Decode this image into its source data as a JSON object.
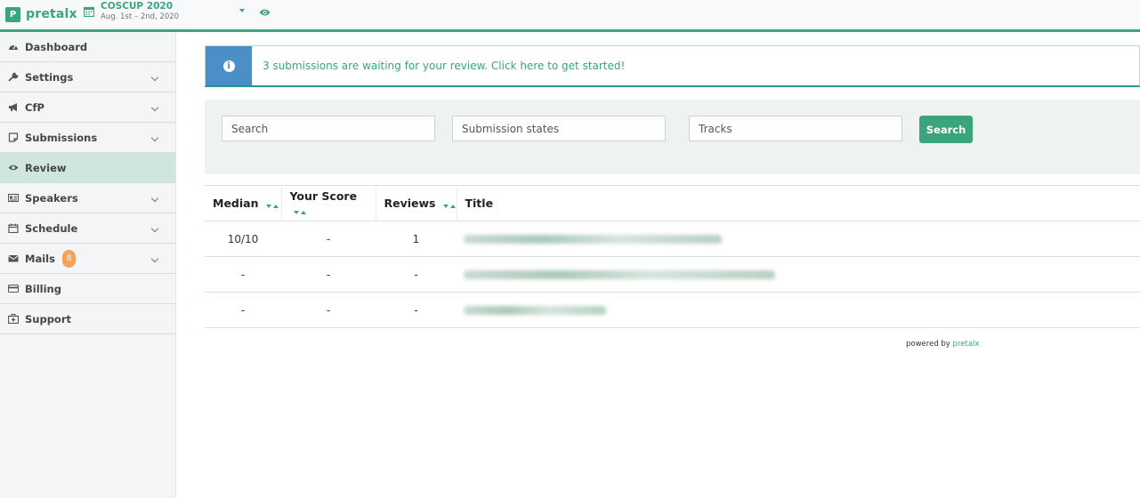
{
  "header": {
    "brand_logo": "P",
    "brand": "pretalx",
    "event_name": "COSCUP 2020",
    "event_dates": "Aug. 1st – 2nd, 2020",
    "accent": "#3aa57c"
  },
  "sidebar": {
    "items": [
      {
        "label": "Dashboard",
        "icon": "dashboard-icon",
        "expandable": false
      },
      {
        "label": "Settings",
        "icon": "wrench-icon",
        "expandable": true
      },
      {
        "label": "CfP",
        "icon": "bullhorn-icon",
        "expandable": true
      },
      {
        "label": "Submissions",
        "icon": "sticky-note-icon",
        "expandable": true
      },
      {
        "label": "Review",
        "icon": "eye-icon",
        "expandable": false,
        "active": true
      },
      {
        "label": "Speakers",
        "icon": "id-card-icon",
        "expandable": true
      },
      {
        "label": "Schedule",
        "icon": "calendar-icon",
        "expandable": true
      },
      {
        "label": "Mails",
        "icon": "envelope-icon",
        "expandable": true,
        "badge": "8"
      },
      {
        "label": "Billing",
        "icon": "credit-card-icon",
        "expandable": false
      },
      {
        "label": "Support",
        "icon": "medkit-icon",
        "expandable": false
      }
    ]
  },
  "alert": {
    "icon": "info-icon",
    "text": "3 submissions are waiting for your review. Click here to get started!"
  },
  "filters": {
    "search_placeholder": "Search",
    "states_placeholder": "Submission states",
    "tracks_placeholder": "Tracks",
    "search_button": "Search"
  },
  "table": {
    "columns": [
      "Median",
      "Your Score",
      "Reviews",
      "Title"
    ],
    "rows": [
      {
        "median": "10/10",
        "your_score": "-",
        "reviews": "1"
      },
      {
        "median": "-",
        "your_score": "-",
        "reviews": "-"
      },
      {
        "median": "-",
        "your_score": "-",
        "reviews": "-"
      }
    ]
  },
  "footer": {
    "powered_by": "powered by",
    "powered_link": "pretalx"
  }
}
